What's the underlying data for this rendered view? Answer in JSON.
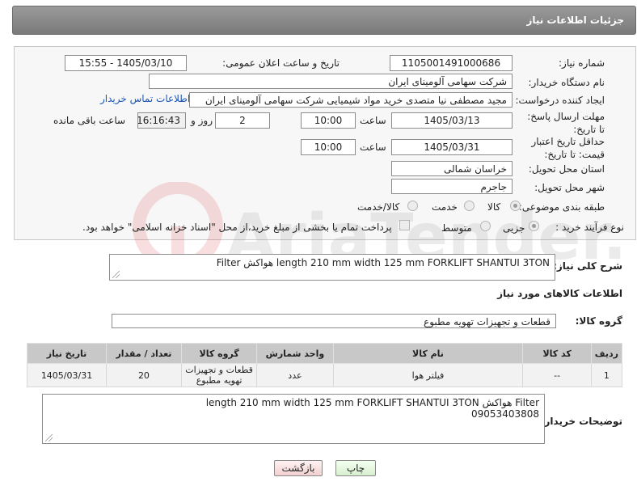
{
  "header": {
    "title": "جزئیات اطلاعات نیاز"
  },
  "form": {
    "need_number_label": "شماره نیاز:",
    "need_number": "1105001491000686",
    "announce_label": "تاریخ و ساعت اعلان عمومی:",
    "announce_value": "1405/03/10 - 15:55",
    "buyer_label": "نام دستگاه خریدار:",
    "buyer_value": "شرکت سهامی آلومینای ایران",
    "creator_label": "ایجاد کننده درخواست:",
    "creator_value": "مجید مصطفی نیا متصدی خرید مواد شیمیایی شرکت سهامی آلومینای ایران",
    "contact_link": "اطلاعات تماس خریدار",
    "reply_deadline_label": "مهلت ارسال پاسخ: تا تاریخ:",
    "reply_date": "1405/03/13",
    "time_label": "ساعت",
    "reply_time": "10:00",
    "days_value": "2",
    "days_label": "روز و",
    "remaining_time": "16:16:43",
    "remaining_label": "ساعت باقی مانده",
    "price_validity_label": "حداقل تاریخ اعتبار قیمت: تا تاریخ:",
    "price_date": "1405/03/31",
    "price_time": "10:00",
    "province_label": "استان محل تحویل:",
    "province_value": "خراسان شمالی",
    "city_label": "شهر محل تحویل:",
    "city_value": "جاجرم",
    "category_label": "طبقه بندی موضوعی:",
    "category_options": [
      "کالا",
      "خدمت",
      "کالا/خدمت"
    ],
    "category_selected": "کالا",
    "process_label": "نوع فرآیند خرید :",
    "process_options": [
      "جزیی",
      "متوسط"
    ],
    "process_selected": "جزیی",
    "payment_note": "پرداخت تمام یا بخشی از مبلغ خرید،از محل \"اسناد خزانه اسلامی\" خواهد بود."
  },
  "description": {
    "label": "شرح کلی نیاز:",
    "text": "Filter هواکش length 210 mm width 125 mm FORKLIFT SHANTUI 3TON"
  },
  "goods": {
    "section_title": "اطلاعات کالاهای مورد نیاز",
    "group_label": "گروه کالا:",
    "group_value": "قطعات و تجهیزات تهویه مطبوع",
    "columns": [
      "ردیف",
      "کد کالا",
      "نام کالا",
      "واحد شمارش",
      "گروه کالا",
      "تعداد / مقدار",
      "تاریخ نیاز"
    ],
    "rows": [
      [
        "1",
        "--",
        "فیلتر هوا",
        "عدد",
        "قطعات و تجهیزات تهویه مطبوع",
        "20",
        "1405/03/31"
      ]
    ]
  },
  "buyer_notes": {
    "label": "توضیحات خریدار:",
    "line1": "Filter هواکش length 210 mm width 125 mm FORKLIFT SHANTUI 3TON",
    "line2": "09053403808"
  },
  "actions": {
    "print": "چاپ",
    "back": "بازگشت"
  },
  "watermark": {
    "text": "AriaTender.net"
  }
}
